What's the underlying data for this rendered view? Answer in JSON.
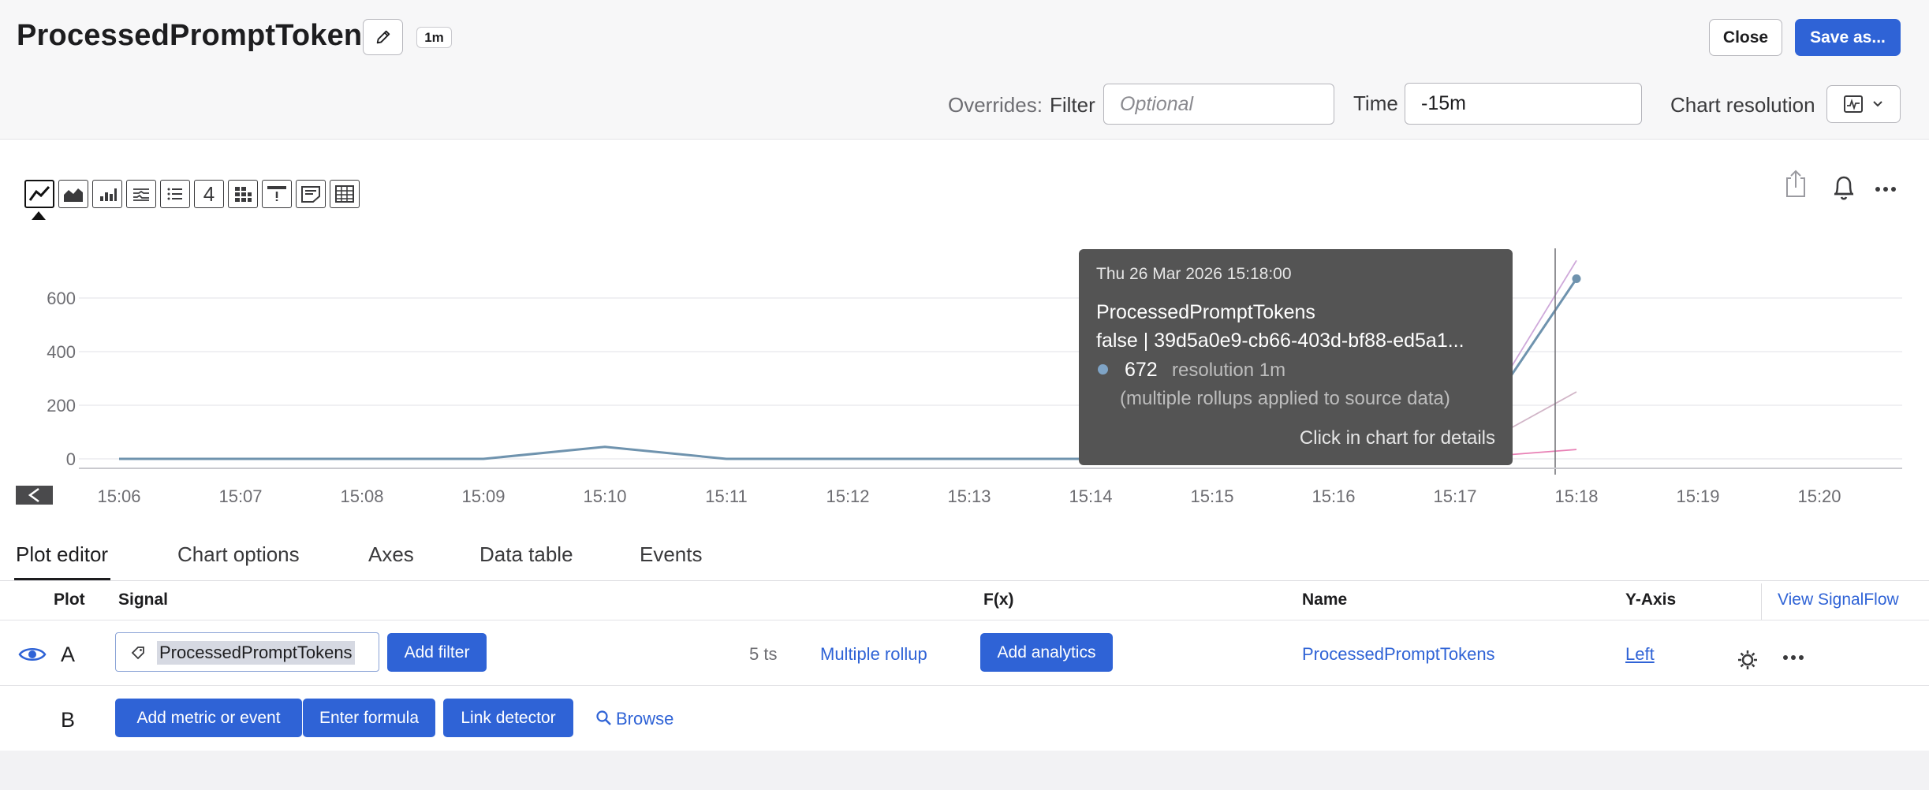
{
  "header": {
    "title": "ProcessedPromptTokens",
    "resolution_badge": "1m",
    "close_label": "Close",
    "save_as_label": "Save as...",
    "overrides_label": "Overrides:",
    "filter_label": "Filter",
    "filter_placeholder": "Optional",
    "time_label": "Time",
    "time_value": "-15m",
    "chart_resolution_label": "Chart resolution"
  },
  "chart_types": [
    "line-chart-icon",
    "area-chart-icon",
    "column-chart-icon",
    "histogram-icon",
    "list-icon",
    "single-value-icon",
    "heatmap-icon",
    "event-feed-icon",
    "text-note-icon",
    "table-icon"
  ],
  "chart_types_single_value_glyph": "4",
  "chart_data": {
    "type": "line",
    "x_ticks": [
      "15:06",
      "15:07",
      "15:08",
      "15:09",
      "15:10",
      "15:11",
      "15:12",
      "15:13",
      "15:14",
      "15:15",
      "15:16",
      "15:17",
      "15:18",
      "15:19",
      "15:20"
    ],
    "y_ticks": [
      0,
      200,
      400,
      600
    ],
    "ylim": [
      0,
      750
    ],
    "series": [
      {
        "color": "#6f93ae",
        "x": [
          "15:06",
          "15:07",
          "15:08",
          "15:09",
          "15:10",
          "15:11",
          "15:12",
          "15:13",
          "15:14",
          "15:15",
          "15:16",
          "15:17",
          "15:18"
        ],
        "values": [
          0,
          0,
          0,
          0,
          45,
          0,
          0,
          0,
          0,
          0,
          0,
          0,
          672
        ]
      },
      {
        "color": "#c79ad4",
        "x": [
          "15:17",
          "15:18"
        ],
        "values": [
          0,
          740
        ]
      },
      {
        "color": "#c9a8bd",
        "x": [
          "15:17",
          "15:18"
        ],
        "values": [
          0,
          250
        ]
      },
      {
        "color": "#e46aa8",
        "x": [
          "15:17",
          "15:18"
        ],
        "values": [
          0,
          35
        ]
      }
    ],
    "hover_x": "15:18"
  },
  "tooltip": {
    "date": "Thu 26 Mar 2026 15:18:00",
    "metric": "ProcessedPromptTokens",
    "series": "false | 39d5a0e9-cb66-403d-bf88-ed5a1...",
    "value": "672",
    "resolution": "resolution 1m",
    "note": "(multiple rollups applied to source data)",
    "hint": "Click in chart for details",
    "dot_color": "#7fa4c6"
  },
  "tabs": [
    "Plot editor",
    "Chart options",
    "Axes",
    "Data table",
    "Events"
  ],
  "table": {
    "headers": {
      "plot": "Plot",
      "signal": "Signal",
      "fx": "F(x)",
      "name": "Name",
      "y_axis": "Y-Axis",
      "view_signalflow": "View SignalFlow"
    },
    "row_a": {
      "letter": "A",
      "signal": "ProcessedPromptTokens",
      "add_filter": "Add filter",
      "ts_count": "5 ts",
      "rollup": "Multiple rollup",
      "add_analytics": "Add analytics",
      "name": "ProcessedPromptTokens",
      "y_axis": "Left"
    },
    "row_b": {
      "letter": "B",
      "add_metric": "Add metric or event",
      "enter_formula": "Enter formula",
      "link_detector": "Link detector",
      "browse": "Browse"
    }
  },
  "colors": {
    "accent": "#2f63d6",
    "tooltip_bg": "#545454"
  }
}
